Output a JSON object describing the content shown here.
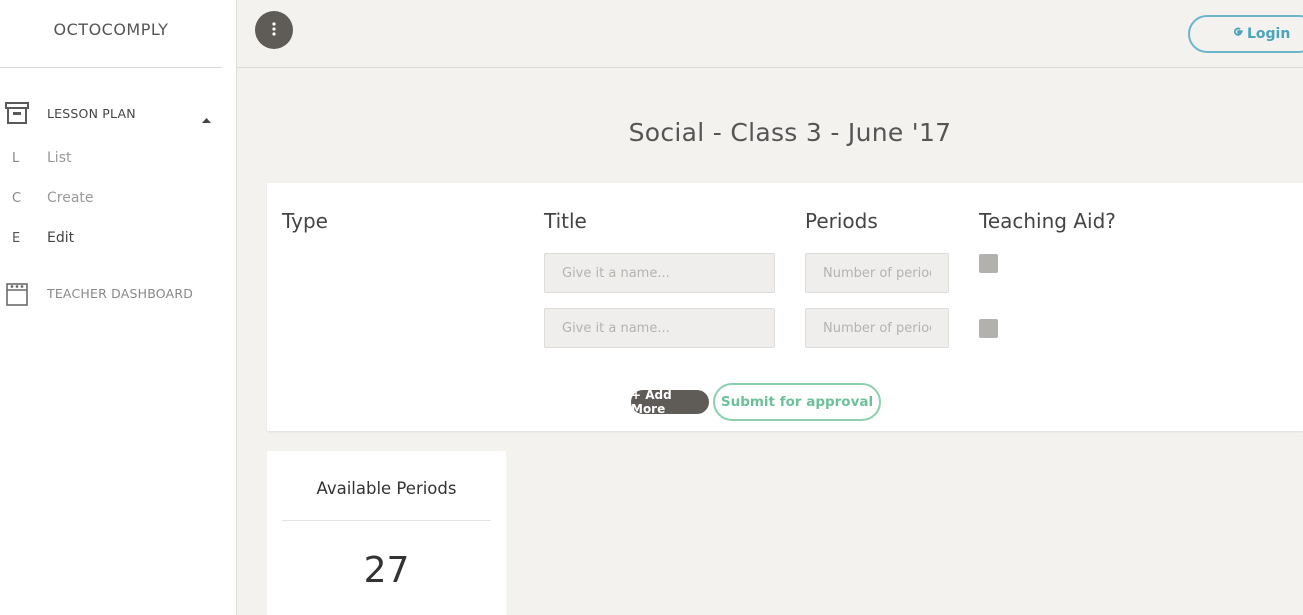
{
  "app": {
    "brand": "OCTOCOMPLY"
  },
  "sidebar": {
    "lesson_plan": {
      "label": "LESSON PLAN",
      "items": [
        {
          "letter": "L",
          "label": "List"
        },
        {
          "letter": "C",
          "label": "Create"
        },
        {
          "letter": "E",
          "label": "Edit"
        }
      ]
    },
    "teacher_dashboard": {
      "label": "TEACHER DASHBOARD"
    }
  },
  "topbar": {
    "login_label": "Login"
  },
  "page": {
    "title": "Social - Class 3 - June '17"
  },
  "form": {
    "headers": {
      "type": "Type",
      "title": "Title",
      "periods": "Periods",
      "teaching_aid": "Teaching Aid?"
    },
    "rows": [
      {
        "title_value": "",
        "title_placeholder": "Give it a name...",
        "periods_value": "",
        "periods_placeholder": "Number of periods"
      },
      {
        "title_value": "",
        "title_placeholder": "Give it a name...",
        "periods_value": "",
        "periods_placeholder": "Number of periods"
      }
    ],
    "add_more_label": "+ Add More",
    "submit_label": "Submit for approval"
  },
  "periods": {
    "title": "Available Periods",
    "value": "27"
  },
  "colors": {
    "accent_blue": "#6cb6cc",
    "accent_green": "#8ccfae",
    "dark_button": "#5f5b57",
    "background": "#f3f2ef"
  }
}
